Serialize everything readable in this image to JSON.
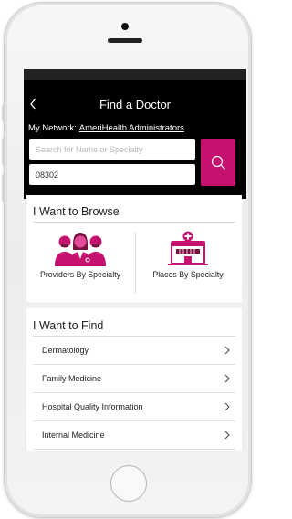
{
  "header": {
    "title": "Find a Doctor",
    "network_label": "My Network:",
    "network_name": "AmeriHealth Administrators"
  },
  "search": {
    "name_placeholder": "Search for Name or Specialty",
    "zip_value": "08302"
  },
  "browse": {
    "title": "I Want to Browse",
    "providers_label": "Providers By Specialty",
    "places_label": "Places By Specialty"
  },
  "find": {
    "title": "I Want to Find",
    "items": [
      {
        "label": "Dermatology"
      },
      {
        "label": "Family Medicine"
      },
      {
        "label": "Hospital Quality Information"
      },
      {
        "label": "Internal Medicine"
      }
    ]
  },
  "colors": {
    "accent": "#c4126e",
    "header_bg": "#000000",
    "icon_dark": "#7a1040"
  },
  "icons": [
    "chevron-left-icon",
    "search-icon",
    "doctors-icon",
    "hospital-icon",
    "chevron-right-icon"
  ]
}
